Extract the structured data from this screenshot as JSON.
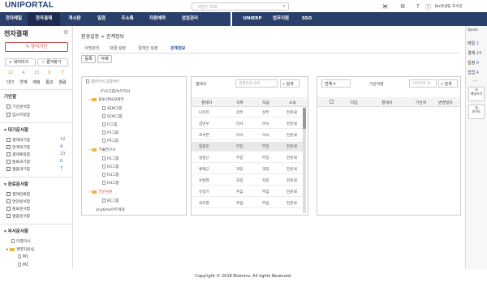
{
  "app": {
    "logo": "UNIPORTAL",
    "search_placeholder": "사원기 조회",
    "user": "Biz컨설팅 조수민"
  },
  "nav": {
    "items": [
      "전자메일",
      "전자결재",
      "게시판",
      "일정",
      "주소록",
      "자원예약",
      "업업관리"
    ],
    "right_items": [
      "UNIERP",
      "업무지원",
      "SSO"
    ]
  },
  "left": {
    "title": "전자결재",
    "write": "양식기안",
    "bookmark": "워터마크",
    "favorites": "즐겨찾기",
    "counts": [
      {
        "num": "12",
        "label": "대기"
      },
      {
        "num": "4",
        "label": "연계"
      },
      {
        "num": "13",
        "label": "예정"
      },
      {
        "num": "0",
        "label": "통보"
      },
      {
        "num": "7",
        "label": "열람"
      }
    ],
    "s1": {
      "title": "기안함",
      "items": [
        "기안문서함",
        "임시저장함"
      ]
    },
    "s2": {
      "title": "대기문서함",
      "items": [
        {
          "label": "결재대기함",
          "num": "12"
        },
        {
          "label": "연계대기함",
          "num": "4"
        },
        {
          "label": "결재예정함",
          "num": "13"
        },
        {
          "label": "통보대기함",
          "num": "0"
        },
        {
          "label": "열람대기함",
          "num": "7"
        }
      ]
    },
    "s3": {
      "title": "완료문서함",
      "items": [
        "결재완료함",
        "연관문서함",
        "통보문서함",
        "열람문서함"
      ]
    },
    "s4": {
      "title": "부서문서함",
      "items": [
        "미결미사",
        "경영지원실",
        "M1",
        "M2"
      ]
    }
  },
  "main": {
    "breadcrumb": "환경설정 > 관계정보",
    "tabs": [
      "서명관리",
      "대결 설정",
      "결재선 설정",
      "관계정보"
    ],
    "btn_register": "등록",
    "btn_delete": "삭제",
    "tree": {
      "header": "해외부서 포함여부",
      "nodes": [
        "IT(G그룹/보부지사",
        "블루션R&D센터",
        "SEM그룹",
        "SCM그룹",
        "FI그룹",
        "P1그룹",
        "P5그룹",
        "기술연구소",
        "R1그룹",
        "R2그룹",
        "R3그룹",
        "R4그룹",
        "전문위원",
        "B1그룹",
        "anytime아무개정"
      ]
    },
    "users": {
      "label": "결재자",
      "placeholder": "결재자명 검색",
      "search": "검색",
      "cols": [
        "결재자",
        "직위",
        "직급",
        "소속"
      ],
      "rows": [
        [
          "나유진",
          "상무",
          "상무",
          "전문내"
        ],
        [
          "김민우",
          "이사",
          "이사",
          "전문내"
        ],
        [
          "조수연",
          "이사",
          "이사",
          "전문내"
        ],
        [
          "임정호",
          "부장",
          "부장",
          "전문내"
        ],
        [
          "김정근",
          "부장",
          "부장",
          "전문내"
        ],
        [
          "류택근",
          "과장",
          "과장",
          "전문내"
        ],
        [
          "유달현",
          "차장",
          "차장",
          "전문내"
        ],
        [
          "유일기",
          "주임",
          "주임",
          "전문내"
        ],
        [
          "석호영",
          "주임",
          "주임",
          "전문내"
        ]
      ]
    },
    "rel": {
      "select": "전체",
      "label": "기안자명",
      "placeholder": "기안자명 검",
      "search": "검색",
      "cols": [
        "타입",
        "결재자",
        "기안자",
        "변경일자"
      ]
    }
  },
  "quick": {
    "title": "Quick",
    "items": [
      {
        "label": "메일",
        "num": "2"
      },
      {
        "label": "결재",
        "num": "24"
      },
      {
        "label": "일정",
        "num": "0"
      },
      {
        "label": "업업",
        "num": "4"
      }
    ],
    "btn1": "메일쓰기",
    "btn2": "조직도"
  },
  "footer": "Copyright © 2018 Bizentro. All rights Reserved."
}
